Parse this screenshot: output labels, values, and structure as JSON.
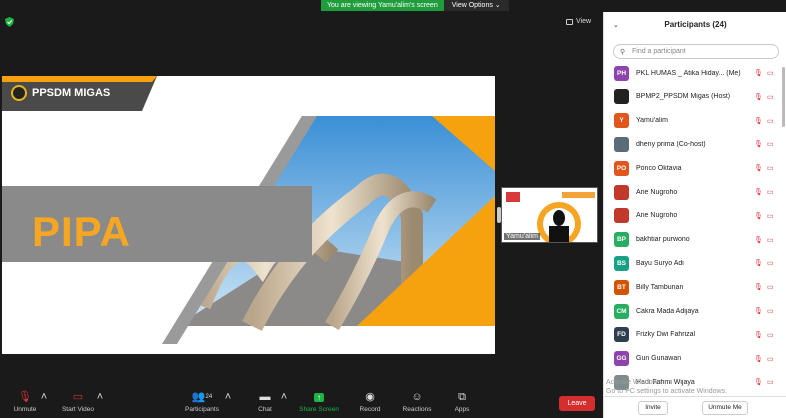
{
  "banner": {
    "message": "You are viewing Yamu'alim's screen",
    "view_options": "View Options ⌄"
  },
  "view_button": "View",
  "slide": {
    "org": "PPSDM MIGAS",
    "title": "PIPA"
  },
  "thumbnail": {
    "name": "Yamu'alim"
  },
  "panel": {
    "title": "Participants (24)",
    "search_placeholder": "Find a participant",
    "invite": "Invite",
    "unmute_me": "Unmute Me",
    "participants": [
      {
        "initials": "PH",
        "name": "PKL HUMAS _ Atika Hiday... (Me)",
        "color": "#8e44ad"
      },
      {
        "initials": "",
        "name": "BPMP2_PPSDM Migas (Host)",
        "color": "#222222"
      },
      {
        "initials": "Y",
        "name": "Yamu'alim",
        "color": "#e0561c"
      },
      {
        "initials": "",
        "name": "dheny prima (Co-host)",
        "color": "#5a6b7a"
      },
      {
        "initials": "PO",
        "name": "Ponco Oktavia",
        "color": "#e0561c"
      },
      {
        "initials": "",
        "name": "Arie Nugroho",
        "color": "#c0392b"
      },
      {
        "initials": "",
        "name": "Arie Nugroho",
        "color": "#c0392b"
      },
      {
        "initials": "BP",
        "name": "bakhtiar purwono",
        "color": "#27ae60"
      },
      {
        "initials": "BS",
        "name": "Bayu Suryo Adi",
        "color": "#16a085"
      },
      {
        "initials": "BT",
        "name": "Billy Tamburian",
        "color": "#d35400"
      },
      {
        "initials": "CM",
        "name": "Cakra Mada Adijaya",
        "color": "#27ae60"
      },
      {
        "initials": "FD",
        "name": "Frizky Dwi Fahrizal",
        "color": "#2c3e50"
      },
      {
        "initials": "GG",
        "name": "Gun Gunawan",
        "color": "#8e44ad"
      },
      {
        "initials": "",
        "name": "Hadi Fahmi Wijaya",
        "color": "#7f8c8d"
      }
    ]
  },
  "activate": "Activate Windows\nGo to PC settings to activate Windows.",
  "toolbar": {
    "unmute": "Unmute",
    "start_video": "Start Video",
    "participants": "Participants",
    "participants_count": "24",
    "chat": "Chat",
    "share_screen": "Share Screen",
    "record": "Record",
    "reactions": "Reactions",
    "apps": "Apps",
    "leave": "Leave"
  }
}
